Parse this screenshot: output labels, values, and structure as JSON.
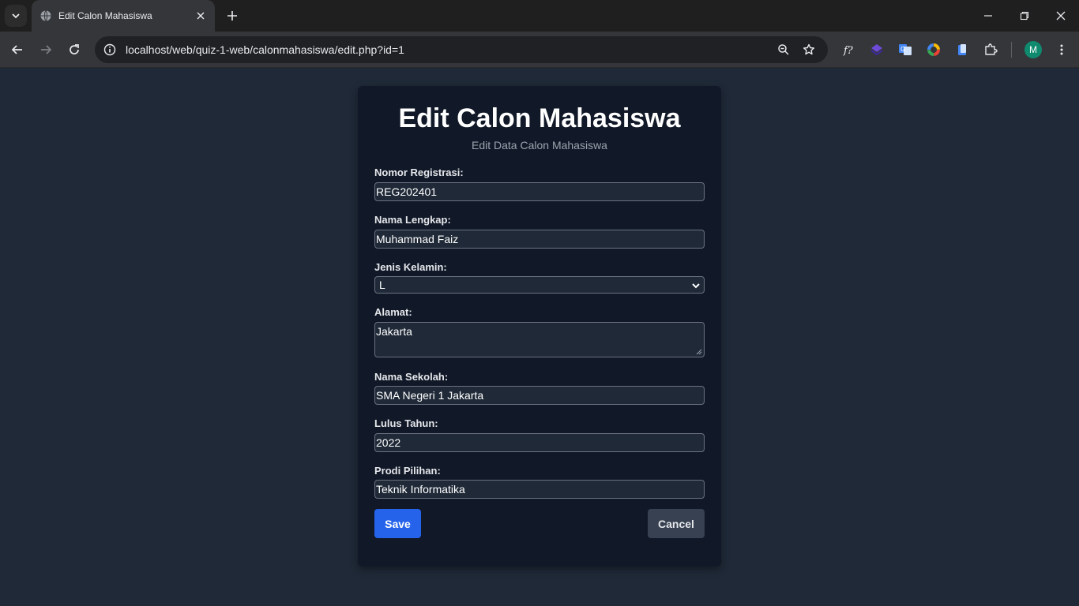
{
  "browser": {
    "tab_title": "Edit Calon Mahasiswa",
    "url": "localhost/web/quiz-1-web/calonmahasiswa/edit.php?id=1",
    "profile_initial": "M",
    "extensions": [
      "formula-icon",
      "layers-icon",
      "translate-icon",
      "color-wheel-icon",
      "clipboard-icon",
      "puzzle-icon"
    ]
  },
  "page": {
    "title": "Edit Calon Mahasiswa",
    "subtitle": "Edit Data Calon Mahasiswa",
    "fields": {
      "nomor_registrasi": {
        "label": "Nomor Registrasi:",
        "value": "REG202401"
      },
      "nama_lengkap": {
        "label": "Nama Lengkap:",
        "value": "Muhammad Faiz"
      },
      "jenis_kelamin": {
        "label": "Jenis Kelamin:",
        "value": "L"
      },
      "alamat": {
        "label": "Alamat:",
        "value": "Jakarta"
      },
      "nama_sekolah": {
        "label": "Nama Sekolah:",
        "value": "SMA Negeri 1 Jakarta"
      },
      "lulus_tahun": {
        "label": "Lulus Tahun:",
        "value": "2022"
      },
      "prodi_pilihan": {
        "label": "Prodi Pilihan:",
        "value": "Teknik Informatika"
      }
    },
    "save_label": "Save",
    "cancel_label": "Cancel"
  },
  "colors": {
    "background": "#1f2937",
    "card": "#111827",
    "primary": "#2563eb",
    "secondary": "#374151"
  }
}
